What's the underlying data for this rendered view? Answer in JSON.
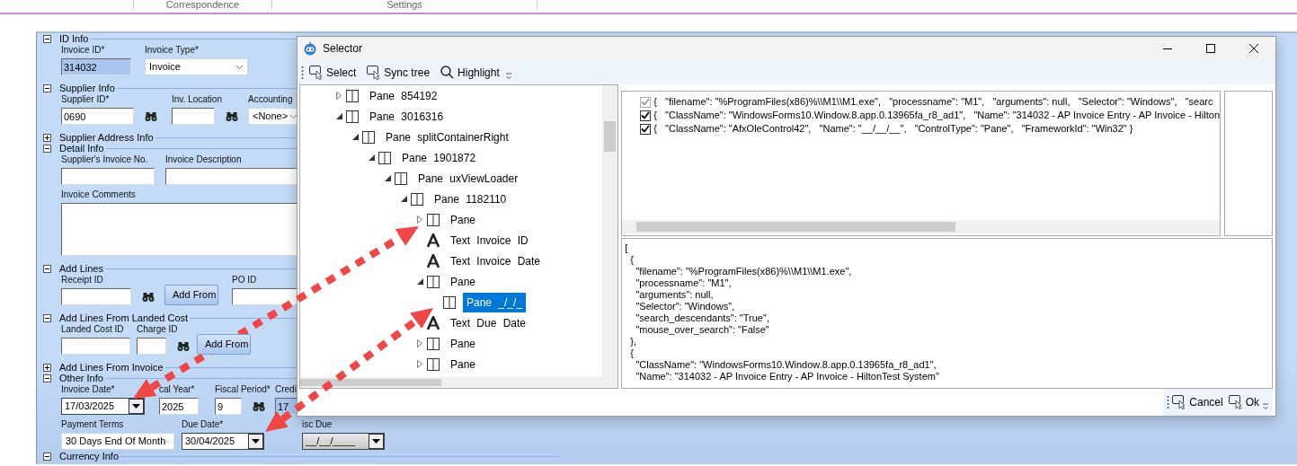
{
  "ribbon": {
    "groups": [
      {
        "label": "Correspondence"
      },
      {
        "label": "Settings"
      }
    ]
  },
  "form": {
    "sections": [
      {
        "title": "ID Info",
        "expanded": true,
        "rows": [
          {
            "fields": [
              {
                "label": "Invoice ID*",
                "kind": "text",
                "value": "314032",
                "disabled": true
              },
              {
                "label": "Invoice Type*",
                "kind": "select",
                "value": "Invoice",
                "disabled": false
              }
            ]
          }
        ]
      },
      {
        "title": "Supplier Info",
        "expanded": true,
        "rows": [
          {
            "fields": [
              {
                "label": "Supplier ID*",
                "kind": "lookup",
                "value": "0690",
                "disabled": false
              },
              {
                "label": "Inv. Location",
                "kind": "lookup",
                "disabled": false
              },
              {
                "label": "Accounting",
                "kind": "select",
                "value": "<None>",
                "disabled": false
              }
            ]
          }
        ]
      },
      {
        "title": "Supplier Address Info",
        "expanded": false
      },
      {
        "title": "Detail Info",
        "expanded": true,
        "rows": [
          {
            "fields": [
              {
                "label": "Supplier's Invoice No.",
                "kind": "text",
                "disabled": false
              },
              {
                "label": "Invoice Description",
                "kind": "text",
                "disabled": false
              }
            ]
          },
          {
            "fields": [
              {
                "label": "Invoice Comments",
                "kind": "textarea",
                "disabled": false
              }
            ]
          }
        ]
      },
      {
        "title": "Add Lines",
        "expanded": true,
        "rows": [
          {
            "fields": [
              {
                "label": "Receipt ID",
                "kind": "lookup",
                "disabled": false
              },
              {
                "label": "Add From",
                "kind": "button",
                "disabled": false
              },
              {
                "label": "PO ID",
                "kind": "text",
                "disabled": false
              }
            ]
          }
        ]
      },
      {
        "title": "Add Lines From Landed Cost",
        "expanded": true,
        "rows": [
          {
            "fields": [
              {
                "label": "Landed Cost ID",
                "kind": "text",
                "disabled": false
              },
              {
                "label": "Charge ID",
                "kind": "lookup",
                "disabled": false
              },
              {
                "label": "Add From",
                "kind": "button",
                "disabled": false
              }
            ]
          }
        ]
      },
      {
        "title": "Add Lines From Invoice",
        "expanded": false
      },
      {
        "title": "Other Info",
        "expanded": true,
        "rows": [
          {
            "fields": [
              {
                "label": "Invoice Date*",
                "kind": "date",
                "value": "17/03/2025",
                "disabled": false
              },
              {
                "label": "cal Year*",
                "kind": "text",
                "value": "2025",
                "disabled": false
              },
              {
                "label": "Fiscal Period*",
                "kind": "lookup",
                "value": "9",
                "disabled": false
              },
              {
                "label": "Credi",
                "kind": "text",
                "value": "17",
                "disabled": true
              }
            ]
          },
          {
            "fields": [
              {
                "label": "Payment Terms",
                "kind": "select",
                "value": "30 Days End Of Month",
                "disabled": false
              },
              {
                "label": "Due Date*",
                "kind": "date",
                "value": "30/04/2025",
                "disabled": false
              },
              {
                "label": "isc Due",
                "kind": "date",
                "value": "__/__/____",
                "disabled": true
              }
            ]
          }
        ]
      },
      {
        "title": "Currency Info",
        "expanded": true
      }
    ]
  },
  "selector": {
    "title": "Selector",
    "toolbar": [
      {
        "label": "Select",
        "kind": "pointer"
      },
      {
        "label": "Sync tree",
        "kind": "pointer"
      },
      {
        "label": "Highlight",
        "kind": "search"
      }
    ],
    "tree": [
      {
        "label": "Pane 854192",
        "kind": "pane",
        "expanded": false,
        "selected": false
      },
      {
        "label": "Pane 3016316",
        "kind": "pane",
        "expanded": true,
        "selected": false,
        "children": [
          {
            "label": "Pane splitContainerRight",
            "kind": "pane",
            "expanded": true,
            "selected": false,
            "children": [
              {
                "label": "Pane 1901872",
                "kind": "pane",
                "expanded": true,
                "selected": false,
                "children": [
                  {
                    "label": "Pane uxViewLoader",
                    "kind": "pane",
                    "expanded": true,
                    "selected": false,
                    "children": [
                      {
                        "label": "Pane 1182110",
                        "kind": "pane",
                        "expanded": true,
                        "selected": false,
                        "children": [
                          {
                            "label": "Pane",
                            "kind": "pane",
                            "expanded": false,
                            "selected": false
                          },
                          {
                            "label": "Text Invoice ID",
                            "kind": "text",
                            "selected": false
                          },
                          {
                            "label": "Text Invoice Date",
                            "kind": "text",
                            "selected": false
                          },
                          {
                            "label": "Pane",
                            "kind": "pane",
                            "expanded": true,
                            "selected": false,
                            "children": [
                              {
                                "label": "Pane _/_/_",
                                "kind": "pane",
                                "selected": true
                              }
                            ]
                          },
                          {
                            "label": "Text Due Date",
                            "kind": "text",
                            "selected": false
                          },
                          {
                            "label": "Pane",
                            "kind": "pane",
                            "expanded": false,
                            "selected": false
                          },
                          {
                            "label": "Pane",
                            "kind": "pane",
                            "expanded": false,
                            "selected": false
                          }
                        ]
                      }
                    ]
                  }
                ]
              }
            ]
          }
        ]
      }
    ],
    "selectors": [
      {
        "text": "{   \"filename\": \"%ProgramFiles(x86)%\\\\M1\\\\M1.exe\",   \"processname\": \"M1\",   \"arguments\": null,   \"Selector\": \"Windows\",   \"searc",
        "checked": true,
        "disabled": true
      },
      {
        "text": "{   \"ClassName\": \"WindowsForms10.Window.8.app.0.13965fa_r8_ad1\",   \"Name\": \"314032 - AP Invoice Entry - AP Invoice - Hilton",
        "checked": true,
        "disabled": false
      },
      {
        "text": "{   \"ClassName\": \"AfxOleControl42\",   \"Name\": \"__/__/__\",   \"ControlType\": \"Pane\",   \"FrameworkId\": \"Win32\" }",
        "checked": true,
        "disabled": false
      }
    ],
    "json_lines": [
      "[",
      "  {",
      "    \"filename\": \"%ProgramFiles(x86)%\\\\M1\\\\M1.exe\",",
      "    \"processname\": \"M1\",",
      "    \"arguments\": null,",
      "    \"Selector\": \"Windows\",",
      "    \"search_descendants\": \"True\",",
      "    \"mouse_over_search\": \"False\"",
      "  },",
      "  {",
      "    \"ClassName\": \"WindowsForms10.Window.8.app.0.13965fa_r8_ad1\",",
      "    \"Name\": \"314032 - AP Invoice Entry - AP Invoice - HiltonTest System\""
    ],
    "footer": [
      {
        "label": "Cancel"
      },
      {
        "label": "Ok"
      }
    ]
  }
}
